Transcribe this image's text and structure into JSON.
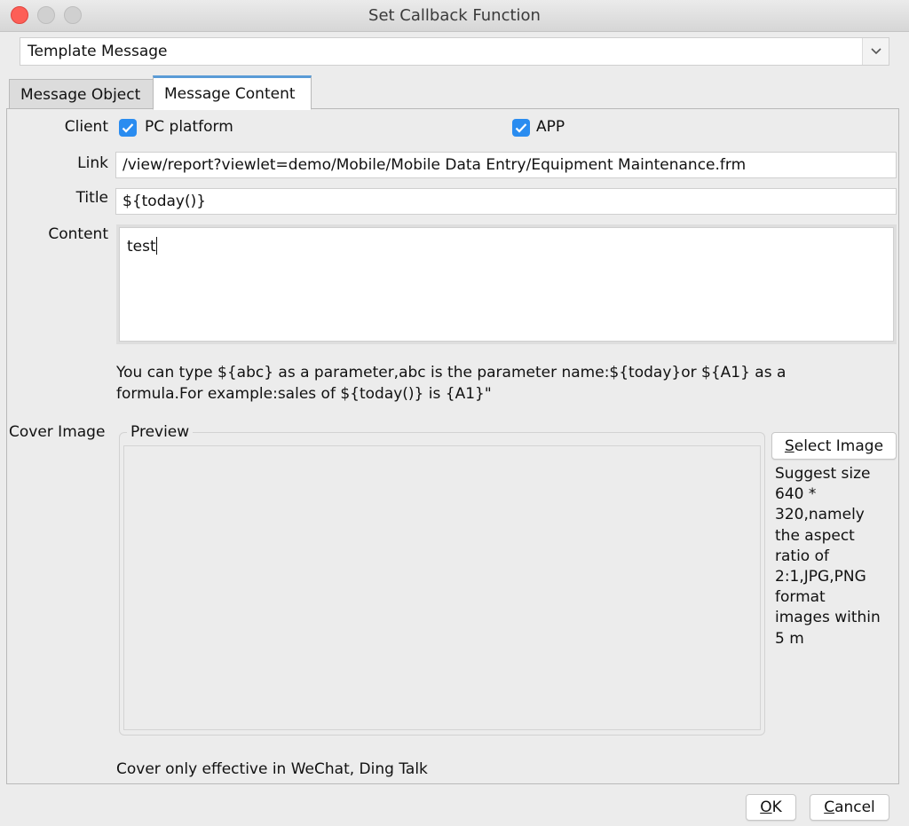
{
  "window": {
    "title": "Set Callback Function"
  },
  "message_type": {
    "value": "Template Message"
  },
  "tabs": [
    {
      "label": "Message Object",
      "active": false
    },
    {
      "label": "Message Content",
      "active": true
    }
  ],
  "form": {
    "client": {
      "label": "Client",
      "options": [
        {
          "label": "PC platform",
          "checked": true
        },
        {
          "label": "APP",
          "checked": true
        }
      ]
    },
    "link": {
      "label": "Link",
      "value": "/view/report?viewlet=demo/Mobile/Mobile Data Entry/Equipment Maintenance.frm"
    },
    "title": {
      "label": "Title",
      "value": "${today()}"
    },
    "content": {
      "label": "Content",
      "value": "test"
    },
    "hint_line1": "You can type ${abc} as a parameter,abc is the parameter name:${today}or ${A1} as a",
    "hint_line2": "formula.For example:sales of ${today()} is {A1}\"",
    "cover": {
      "label": "Cover Image",
      "preview_label": "Preview",
      "select_button": {
        "mnemonic": "S",
        "rest": "elect Image"
      },
      "suggest_lines": [
        "Suggest size",
        "640 *",
        "320,namely",
        "the aspect",
        "ratio of",
        "2:1,JPG,PNG",
        "format",
        "images within",
        "5 m"
      ],
      "note": "Cover only effective in WeChat, Ding Talk"
    }
  },
  "buttons": {
    "ok": {
      "mnemonic": "O",
      "rest": "K"
    },
    "cancel": {
      "mnemonic": "C",
      "rest": "ancel"
    }
  },
  "icons": {
    "checkbox": "checkmark-icon",
    "combo": "chevron-down-icon"
  },
  "colors": {
    "accent": "#2a8cf0",
    "close_button": "#fd5f57",
    "tab_active_border": "#5a9bd6"
  }
}
